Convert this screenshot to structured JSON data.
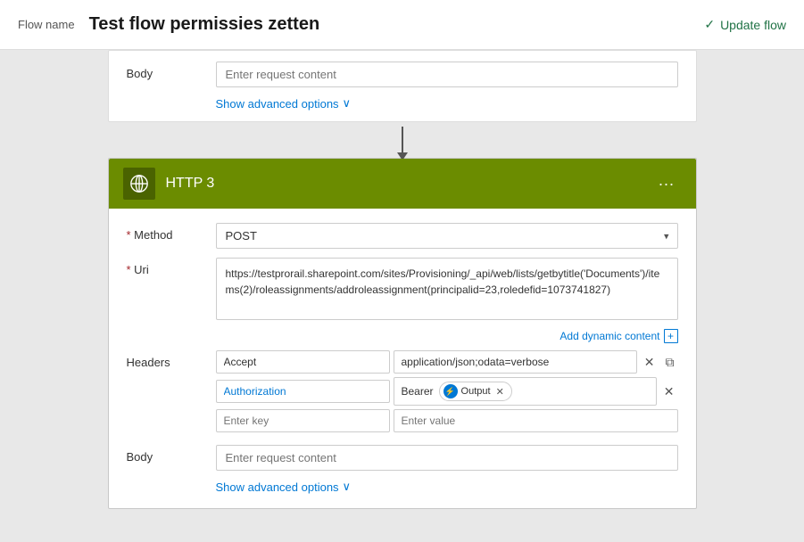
{
  "header": {
    "flow_name_label": "Flow name",
    "flow_title": "Test flow permissies zetten",
    "update_flow_label": "Update flow"
  },
  "card_partial": {
    "body_label": "Body",
    "body_placeholder": "Enter request content",
    "advanced_options_label": "Show advanced options"
  },
  "connector": {
    "arrow": "↓"
  },
  "card": {
    "title": "HTTP 3",
    "menu_dots": "···",
    "method_label": "* Method",
    "method_value": "POST",
    "uri_label": "* Uri",
    "uri_value": "https://testprorail.sharepoint.com/sites/Provisioning/_api/web/lists/getbytitle('Documents')/items(2)/roleassignments/addroleassignment(principalid=23,roledefid=1073741827)",
    "dynamic_content_label": "Add dynamic content",
    "headers_label": "Headers",
    "headers": [
      {
        "key": "Accept",
        "value": "application/json;odata=verbose"
      },
      {
        "key": "Authorization",
        "value_prefix": "Bearer",
        "token_label": "Output",
        "value_suffix": ""
      },
      {
        "key_placeholder": "Enter key",
        "value_placeholder": "Enter value"
      }
    ],
    "body_label": "Body",
    "body_placeholder": "Enter request content",
    "advanced_options_label": "Show advanced options"
  }
}
